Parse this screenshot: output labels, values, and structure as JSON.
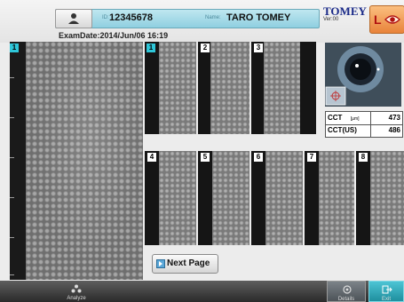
{
  "header": {
    "id_label": "ID:",
    "id_value": "12345678",
    "name_label": "Name:",
    "name_value": "TARO TOMEY",
    "exam_date": "ExamDate:2014/Jun/06 16:19",
    "logo": "TOMEY",
    "version": "Ver:00",
    "eye_button": "L"
  },
  "main_image": {
    "badge": "1"
  },
  "thumbnails_top": [
    {
      "badge": "1"
    },
    {
      "badge": "2"
    },
    {
      "badge": "3"
    }
  ],
  "thumbnails_bottom": [
    {
      "badge": "4"
    },
    {
      "badge": "5"
    },
    {
      "badge": "6"
    },
    {
      "badge": "7"
    },
    {
      "badge": "8"
    }
  ],
  "cct": {
    "row1_label": "CCT",
    "row1_unit": "[µm]",
    "row1_value": "473",
    "row2_label": "CCT(US)",
    "row2_value": "486"
  },
  "next_page_label": "Next Page",
  "bottom_bar": {
    "analyze_label": "Analyze",
    "details_label": "Details",
    "exit_label": "Exit"
  },
  "colors": {
    "accent_cyan": "#2ec6d8",
    "orange_button": "#e8833a",
    "logo_blue": "#1a2a88"
  }
}
